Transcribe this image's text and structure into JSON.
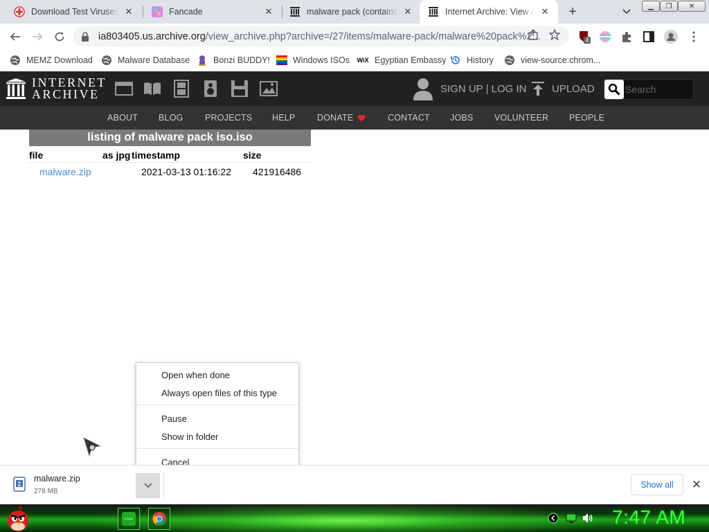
{
  "browser": {
    "tabs": [
      {
        "title": "Download Test Viruses - M",
        "active": false,
        "favicon": "red-cross-icon"
      },
      {
        "title": "Fancade",
        "active": false,
        "favicon": "fancade-icon"
      },
      {
        "title": "malware pack (contains fi",
        "active": false,
        "favicon": "archive-icon"
      },
      {
        "title": "Internet Archive: View Arc",
        "active": true,
        "favicon": "archive-icon"
      }
    ],
    "url_host": "ia803405.us.archive.org",
    "url_path": "/view_archive.php?archive=/27/items/malware-pack/malware%20pack%2...",
    "extension_badge": "4"
  },
  "bookmarks": [
    {
      "label": "MEMZ Download",
      "icon": "globe-icon"
    },
    {
      "label": "Malware Database",
      "icon": "globe-icon"
    },
    {
      "label": "Bonzi BUDDY!",
      "icon": "bonzi-icon"
    },
    {
      "label": "Windows ISOs",
      "icon": "windows-flag-icon"
    },
    {
      "label": "Egyptian Embassy",
      "icon": "wix-icon"
    },
    {
      "label": "History",
      "icon": "history-icon"
    },
    {
      "label": "view-source:chrom...",
      "icon": "globe-icon"
    }
  ],
  "ia": {
    "logo_line1": "INTERNET",
    "logo_line2": "ARCHIVE",
    "signin": "SIGN UP | LOG IN",
    "upload": "UPLOAD",
    "search_placeholder": "Search",
    "nav": [
      "ABOUT",
      "BLOG",
      "PROJECTS",
      "HELP",
      "DONATE",
      "CONTACT",
      "JOBS",
      "VOLUNTEER",
      "PEOPLE"
    ],
    "donate_heart_color": "#e0282e"
  },
  "listing": {
    "title": "listing of malware pack iso.iso",
    "headers": {
      "file": "file",
      "jpg": "as jpg",
      "timestamp": "timestamp",
      "size": "size"
    },
    "rows": [
      {
        "file": "malware.zip",
        "timestamp": "2021-03-13 01:16:22",
        "size": "421916486"
      }
    ]
  },
  "context_menu": {
    "items": [
      "Open when done",
      "Always open files of this type",
      "Pause",
      "Show in folder",
      "Cancel"
    ]
  },
  "download": {
    "filename": "malware.zip",
    "size": "278 MB",
    "show_all": "Show all"
  },
  "taskbar": {
    "clock": "7:47 AM",
    "theme_color": "#1fa61f"
  }
}
